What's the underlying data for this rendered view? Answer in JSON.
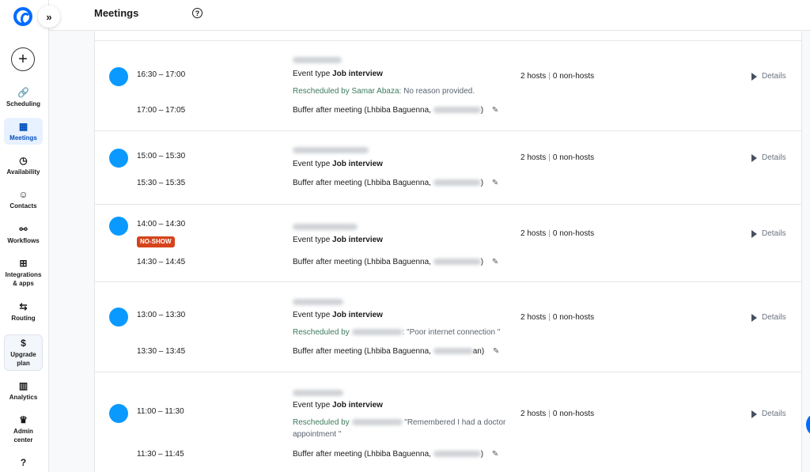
{
  "sidebar": {
    "expand_icon": "»",
    "create_icon": "+",
    "items": [
      {
        "label": "Scheduling",
        "icon": "🔗"
      },
      {
        "label": "Meetings",
        "icon": "▦"
      },
      {
        "label": "Availability",
        "icon": "◷"
      },
      {
        "label": "Contacts",
        "icon": "☺"
      },
      {
        "label": "Workflows",
        "icon": "⚯"
      },
      {
        "label": "Integrations & apps",
        "icon": "⊞"
      },
      {
        "label": "Routing",
        "icon": "⇆"
      },
      {
        "label": "Upgrade plan",
        "icon": "$"
      },
      {
        "label": "Analytics",
        "icon": "▥"
      },
      {
        "label": "Admin center",
        "icon": "♛"
      },
      {
        "label": "",
        "icon": "?"
      }
    ]
  },
  "header": {
    "title": "Meetings",
    "help_icon": "?"
  },
  "meetings": [
    {
      "time": "16:30 – 17:00",
      "event_type_label": "Event type",
      "event_type": "Job interview",
      "reschedule_prefix": "Rescheduled by",
      "reschedule_by": "Samar Abaza:",
      "reschedule_reason": " No reason provided.",
      "buffer_time": "17:00 – 17:05",
      "buffer_text": "Buffer after meeting (Lhbiba Baguenna,",
      "buffer_end": ")",
      "hosts": "2 hosts",
      "non_hosts": "0 non-hosts",
      "details": "Details"
    },
    {
      "time": "15:00 – 15:30",
      "event_type_label": "Event type",
      "event_type": "Job interview",
      "buffer_time": "15:30 – 15:35",
      "buffer_text": "Buffer after meeting (Lhbiba Baguenna,",
      "buffer_end": ")",
      "hosts": "2 hosts",
      "non_hosts": "0 non-hosts",
      "details": "Details"
    },
    {
      "time": "14:00 – 14:30",
      "badge": "NO-SHOW",
      "event_type_label": "Event type",
      "event_type": "Job interview",
      "buffer_time": "14:30 – 14:45",
      "buffer_text": "Buffer after meeting (Lhbiba Baguenna,",
      "buffer_end": ")",
      "hosts": "2 hosts",
      "non_hosts": "0 non-hosts",
      "details": "Details"
    },
    {
      "time": "13:00 – 13:30",
      "event_type_label": "Event type",
      "event_type": "Job interview",
      "reschedule_prefix": "Rescheduled by",
      "reschedule_by": "",
      "reschedule_reason": ": \"Poor internet connection \"",
      "buffer_time": "13:30 – 13:45",
      "buffer_text": "Buffer after meeting (Lhbiba Baguenna,",
      "buffer_end": "an)",
      "hosts": "2 hosts",
      "non_hosts": "0 non-hosts",
      "details": "Details"
    },
    {
      "time": "11:00 – 11:30",
      "event_type_label": "Event type",
      "event_type": "Job interview",
      "reschedule_prefix": "Rescheduled by",
      "reschedule_by": "",
      "reschedule_reason": " \"Remembered I had a doctor",
      "reschedule_reason_2": "appointment \"",
      "buffer_time": "11:30 – 11:45",
      "buffer_text": "Buffer after meeting (Lhbiba Baguenna,",
      "buffer_end": ")",
      "hosts": "2 hosts",
      "non_hosts": "0 non-hosts",
      "details": "Details"
    }
  ],
  "icons": {
    "pencil": "✎",
    "details": "play-triangle-icon"
  },
  "colors": {
    "accent": "#006bff",
    "dot": "#0a99ff",
    "noshow": "#d5431c",
    "reschedule": "#3d7a5e"
  }
}
